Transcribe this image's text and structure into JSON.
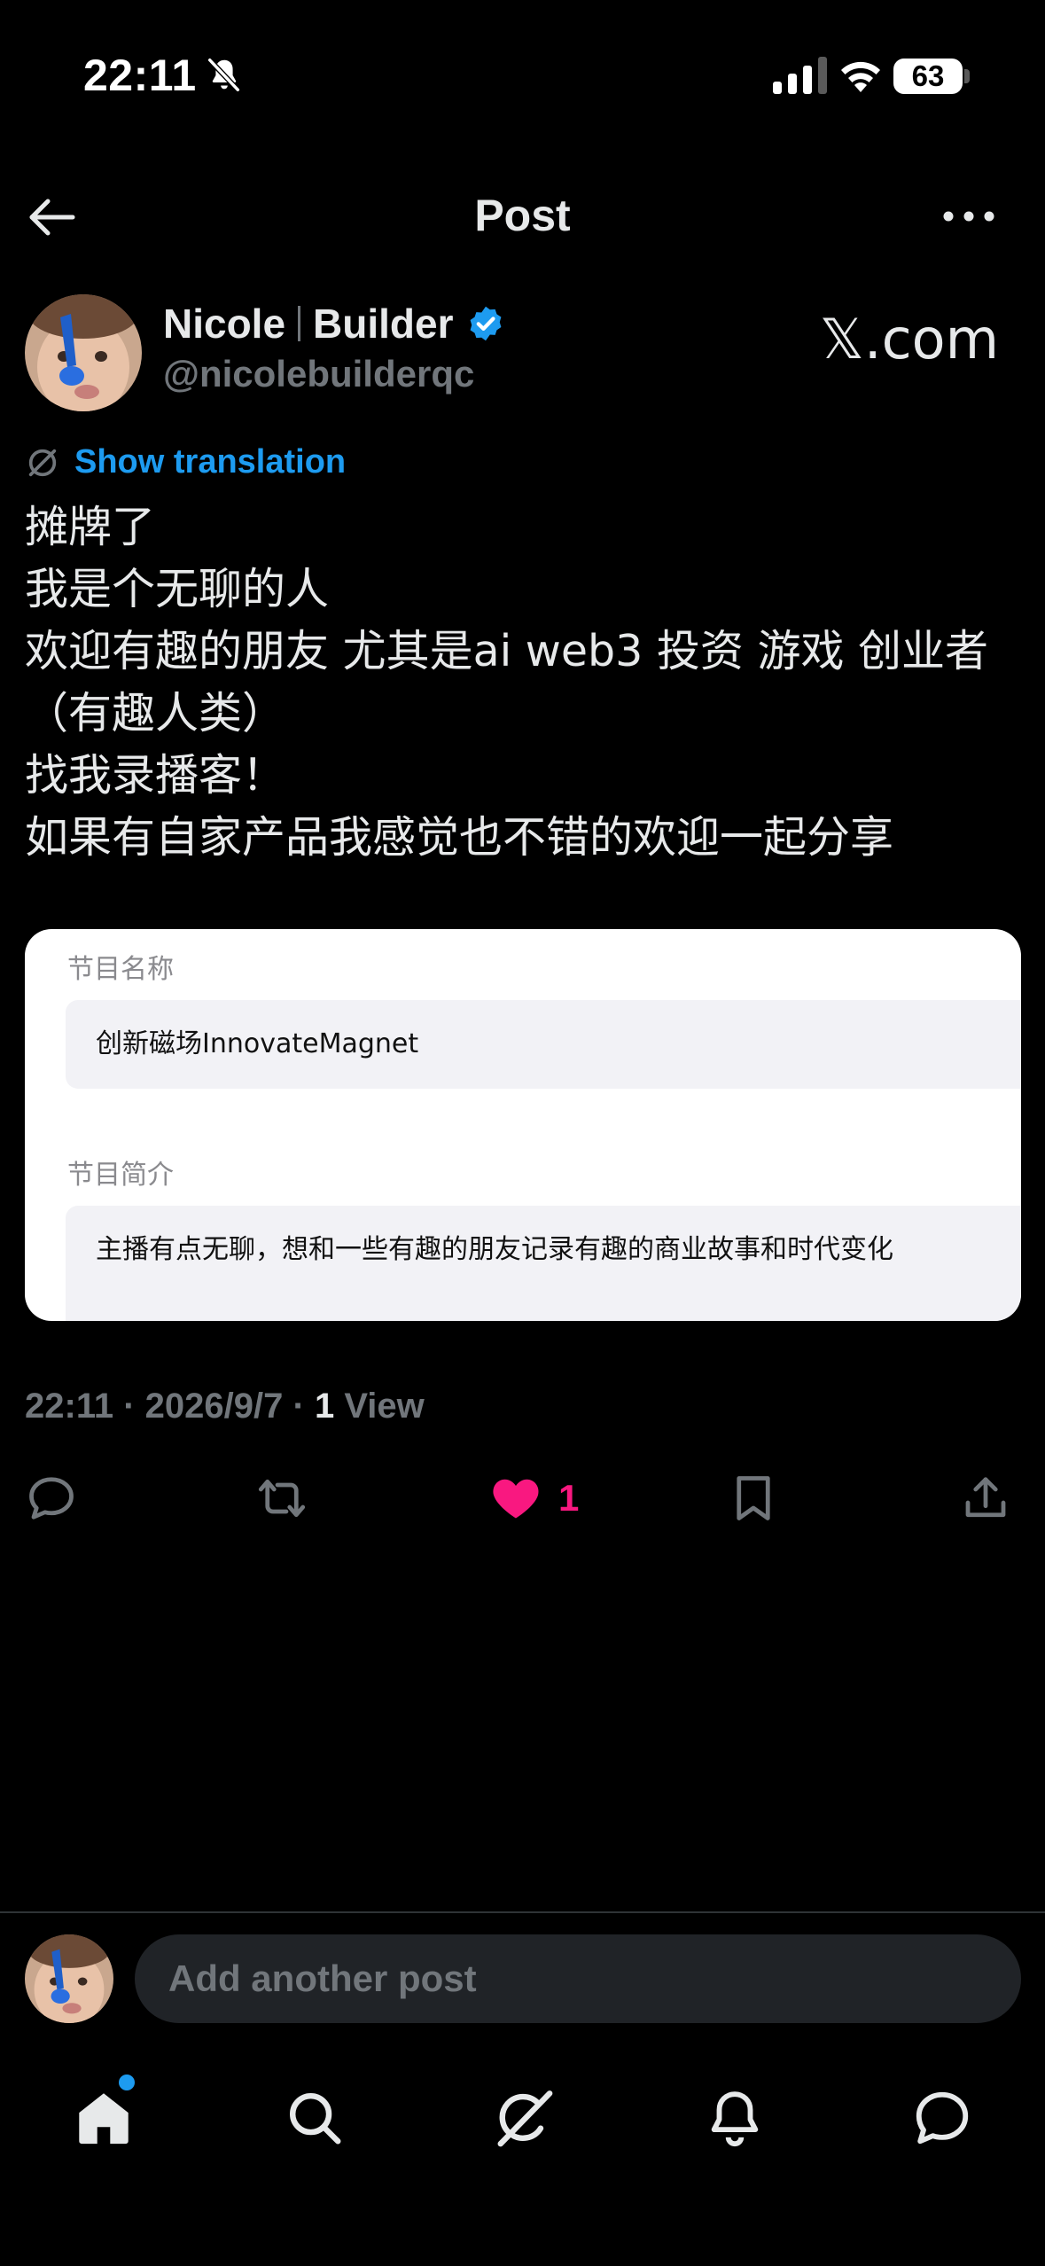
{
  "status_bar": {
    "time": "22:11",
    "battery": "63",
    "icons": [
      "bell-slash-icon",
      "signal-icon",
      "wifi-icon",
      "battery-icon"
    ]
  },
  "header": {
    "title": "Post",
    "back_icon": "arrow-left-icon",
    "more_icon": "ellipsis-icon"
  },
  "author": {
    "name_first": "Nicole",
    "name_second": "Builder",
    "handle": "@nicolebuilderqc",
    "verified": true,
    "source": "𝕏.com"
  },
  "translation": {
    "label": "Show translation"
  },
  "post": {
    "lines": [
      "摊牌了",
      "我是个无聊的人",
      "欢迎有趣的朋友 尤其是ai web3 投资 游戏 创业者",
      "（有趣人类）",
      "找我录播客！",
      "如果有自家产品我感觉也不错的欢迎一起分享"
    ],
    "card": {
      "field1_label": "节目名称",
      "field1_value": "创新磁场InnovateMagnet",
      "field2_label": "节目简介",
      "field2_value": "主播有点无聊，想和一些有趣的朋友记录有趣的商业故事和时代变化"
    },
    "meta": {
      "time": "22:11",
      "date": "2026/9/7",
      "views_count": "1",
      "views_label": "View"
    }
  },
  "actions": {
    "like_count": "1",
    "like_color": "#f91880"
  },
  "reply": {
    "placeholder": "Add another post"
  },
  "colors": {
    "accent": "#1d9bf0",
    "background": "#000000",
    "muted": "#71767b"
  }
}
